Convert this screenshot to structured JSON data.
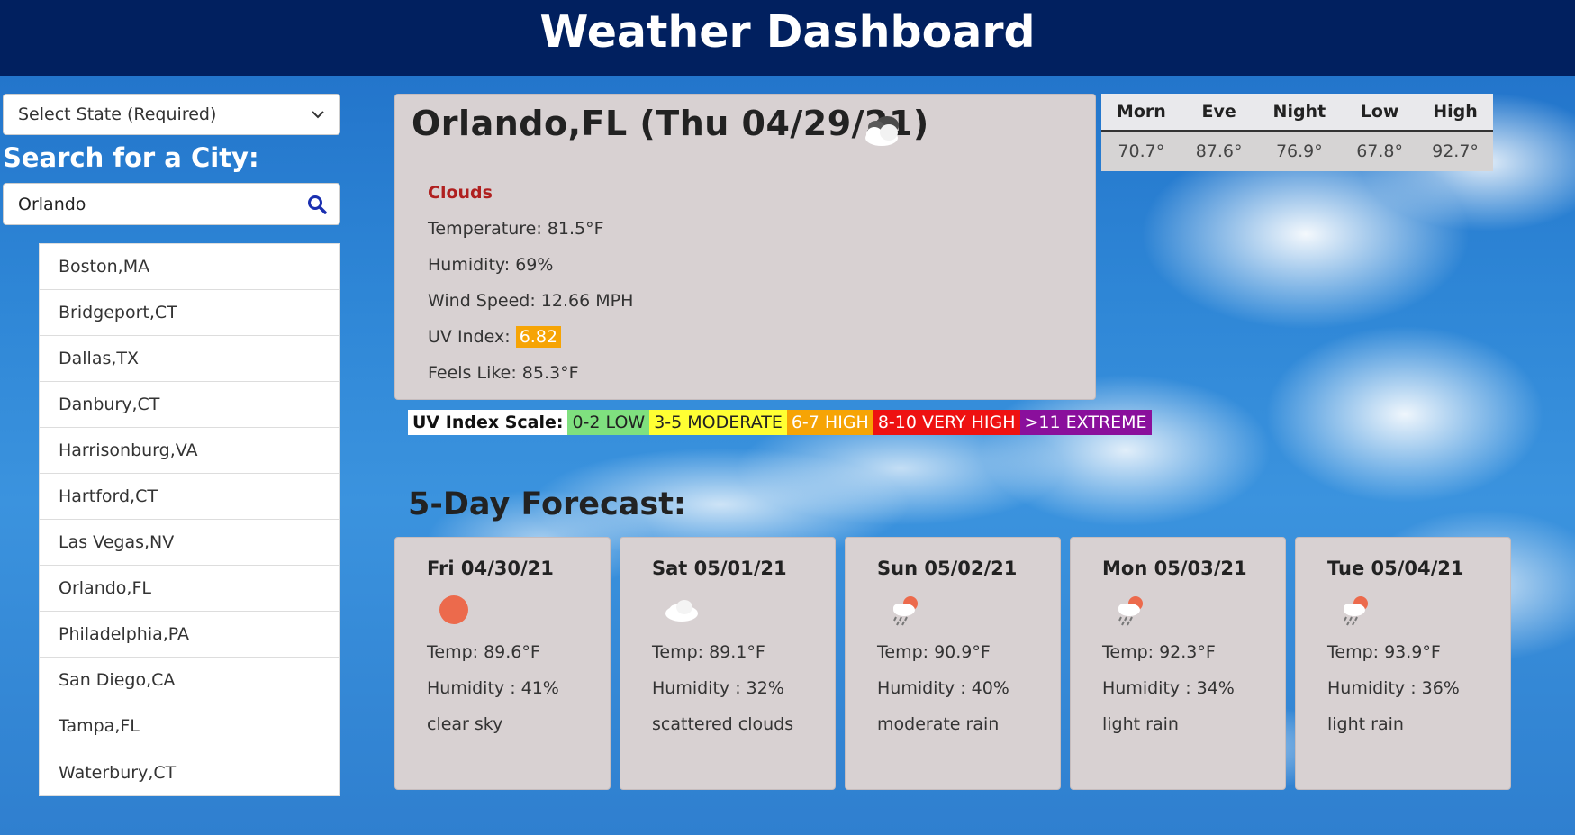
{
  "header": {
    "title": "Weather Dashboard"
  },
  "sidebar": {
    "state_select": "Select State (Required)",
    "search_label": "Search for a City:",
    "search_value": "Orlando",
    "cities": [
      "Boston,MA",
      "Bridgeport,CT",
      "Dallas,TX",
      "Danbury,CT",
      "Harrisonburg,VA",
      "Hartford,CT",
      "Las Vegas,NV",
      "Orlando,FL",
      "Philadelphia,PA",
      "San Diego,CA",
      "Tampa,FL",
      "Waterbury,CT"
    ]
  },
  "current": {
    "title": "Orlando,FL (Thu 04/29/21)",
    "icon": "clouds-icon",
    "condition": "Clouds",
    "temperature": "Temperature: 81.5°F",
    "humidity": "Humidity: 69%",
    "wind": "Wind Speed: 12.66 MPH",
    "uv_label": "UV Index: ",
    "uv_value": "6.82",
    "feels_like": "Feels Like: 85.3°F"
  },
  "hilo": {
    "headers": [
      "Morn",
      "Eve",
      "Night",
      "Low",
      "High"
    ],
    "values": [
      "70.7°",
      "87.6°",
      "76.9°",
      "67.8°",
      "92.7°"
    ]
  },
  "uv_scale": {
    "label": "UV Index Scale:",
    "low": "0-2 LOW",
    "moderate": "3-5 MODERATE",
    "high": "6-7 HIGH",
    "very_high": "8-10 VERY HIGH",
    "extreme": ">11 EXTREME"
  },
  "forecast": {
    "title": "5-Day Forecast:",
    "days": [
      {
        "date": "Fri 04/30/21",
        "icon": "sun-icon",
        "temp": "Temp: 89.6°F",
        "humidity": "Humidity : 41%",
        "desc": "clear sky"
      },
      {
        "date": "Sat 05/01/21",
        "icon": "cloud-icon",
        "temp": "Temp: 89.1°F",
        "humidity": "Humidity : 32%",
        "desc": "scattered clouds"
      },
      {
        "date": "Sun 05/02/21",
        "icon": "rain-icon",
        "temp": "Temp: 90.9°F",
        "humidity": "Humidity : 40%",
        "desc": "moderate rain"
      },
      {
        "date": "Mon 05/03/21",
        "icon": "rain-icon",
        "temp": "Temp: 92.3°F",
        "humidity": "Humidity : 34%",
        "desc": "light rain"
      },
      {
        "date": "Tue 05/04/21",
        "icon": "rain-icon",
        "temp": "Temp: 93.9°F",
        "humidity": "Humidity : 36%",
        "desc": "light rain"
      }
    ]
  },
  "colors": {
    "header_bg": "#01205f",
    "card_bg": "#d8d1d2",
    "condition_text": "#b02020",
    "uv_high": "#f6a405"
  }
}
